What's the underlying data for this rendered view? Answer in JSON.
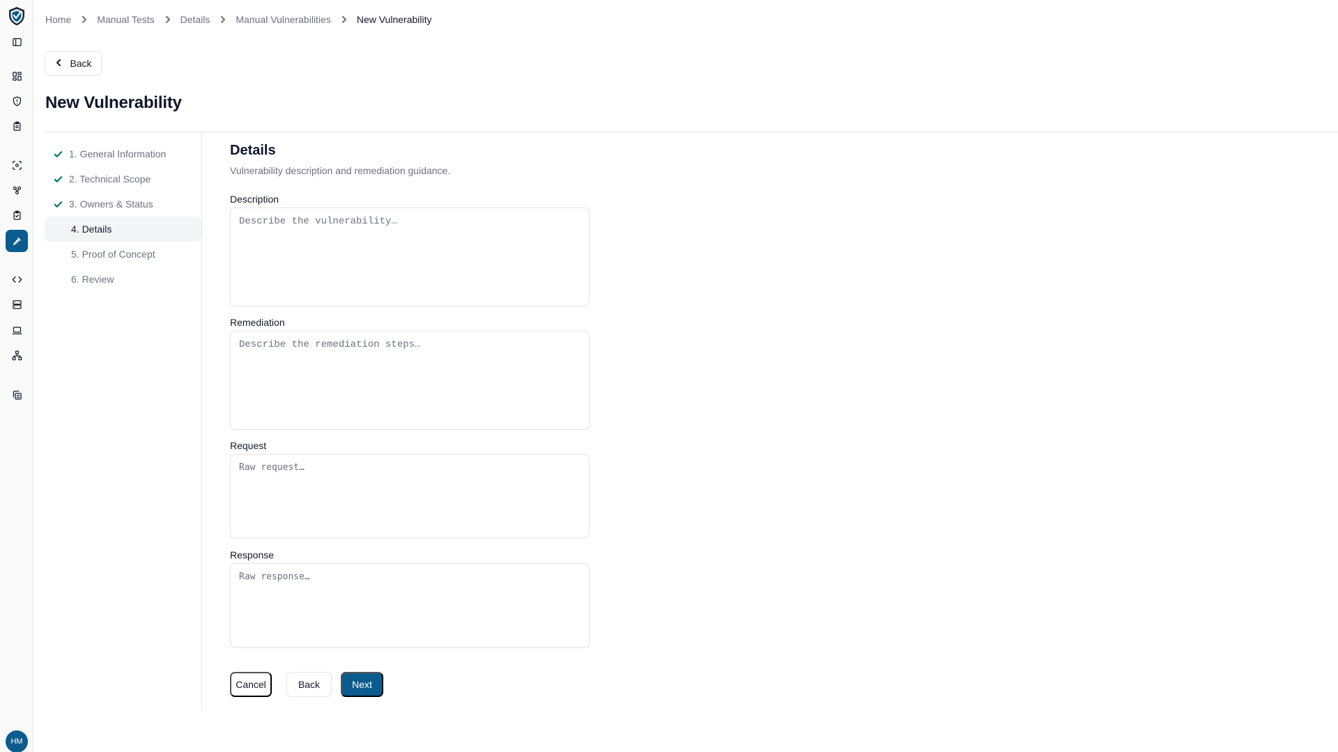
{
  "app": {
    "accent": "#0b5c8e",
    "user_initials": "HM"
  },
  "rail": {
    "logo_icon": "shield-logo-icon",
    "items": [
      {
        "icon": "sidebar-toggle-icon"
      },
      {
        "icon": "dashboard-grid-icon"
      },
      {
        "icon": "shield-alert-icon"
      },
      {
        "icon": "clipboard-list-icon"
      },
      {
        "icon": "scan-icon"
      },
      {
        "icon": "integrations-icon"
      },
      {
        "icon": "clipboard-check-icon"
      },
      {
        "icon": "manual-tests-icon",
        "active": true
      },
      {
        "icon": "code-icon"
      },
      {
        "icon": "server-icon"
      },
      {
        "icon": "laptop-icon"
      },
      {
        "icon": "network-icon"
      },
      {
        "icon": "copy-docs-icon"
      }
    ]
  },
  "breadcrumb": {
    "items": [
      "Home",
      "Manual Tests",
      "Details",
      "Manual Vulnerabilities"
    ],
    "current": "New Vulnerability"
  },
  "header": {
    "back_label": "Back",
    "title": "New Vulnerability"
  },
  "steps": [
    {
      "label": "1. General Information",
      "status": "complete"
    },
    {
      "label": "2. Technical Scope",
      "status": "complete"
    },
    {
      "label": "3. Owners & Status",
      "status": "complete"
    },
    {
      "label": "4. Details",
      "status": "current"
    },
    {
      "label": "5. Proof of Concept",
      "status": "pending"
    },
    {
      "label": "6. Review",
      "status": "pending"
    }
  ],
  "form": {
    "title": "Details",
    "subtitle": "Vulnerability description and remediation guidance.",
    "description": {
      "label": "Description",
      "value": "",
      "placeholder": "Describe the vulnerability…"
    },
    "remediation": {
      "label": "Remediation",
      "value": "",
      "placeholder": "Describe the remediation steps…"
    },
    "request": {
      "label": "Request",
      "value": "",
      "placeholder": "Raw request…"
    },
    "response": {
      "label": "Response",
      "value": "",
      "placeholder": "Raw response…"
    }
  },
  "actions": {
    "cancel": "Cancel",
    "back": "Back",
    "next": "Next"
  }
}
